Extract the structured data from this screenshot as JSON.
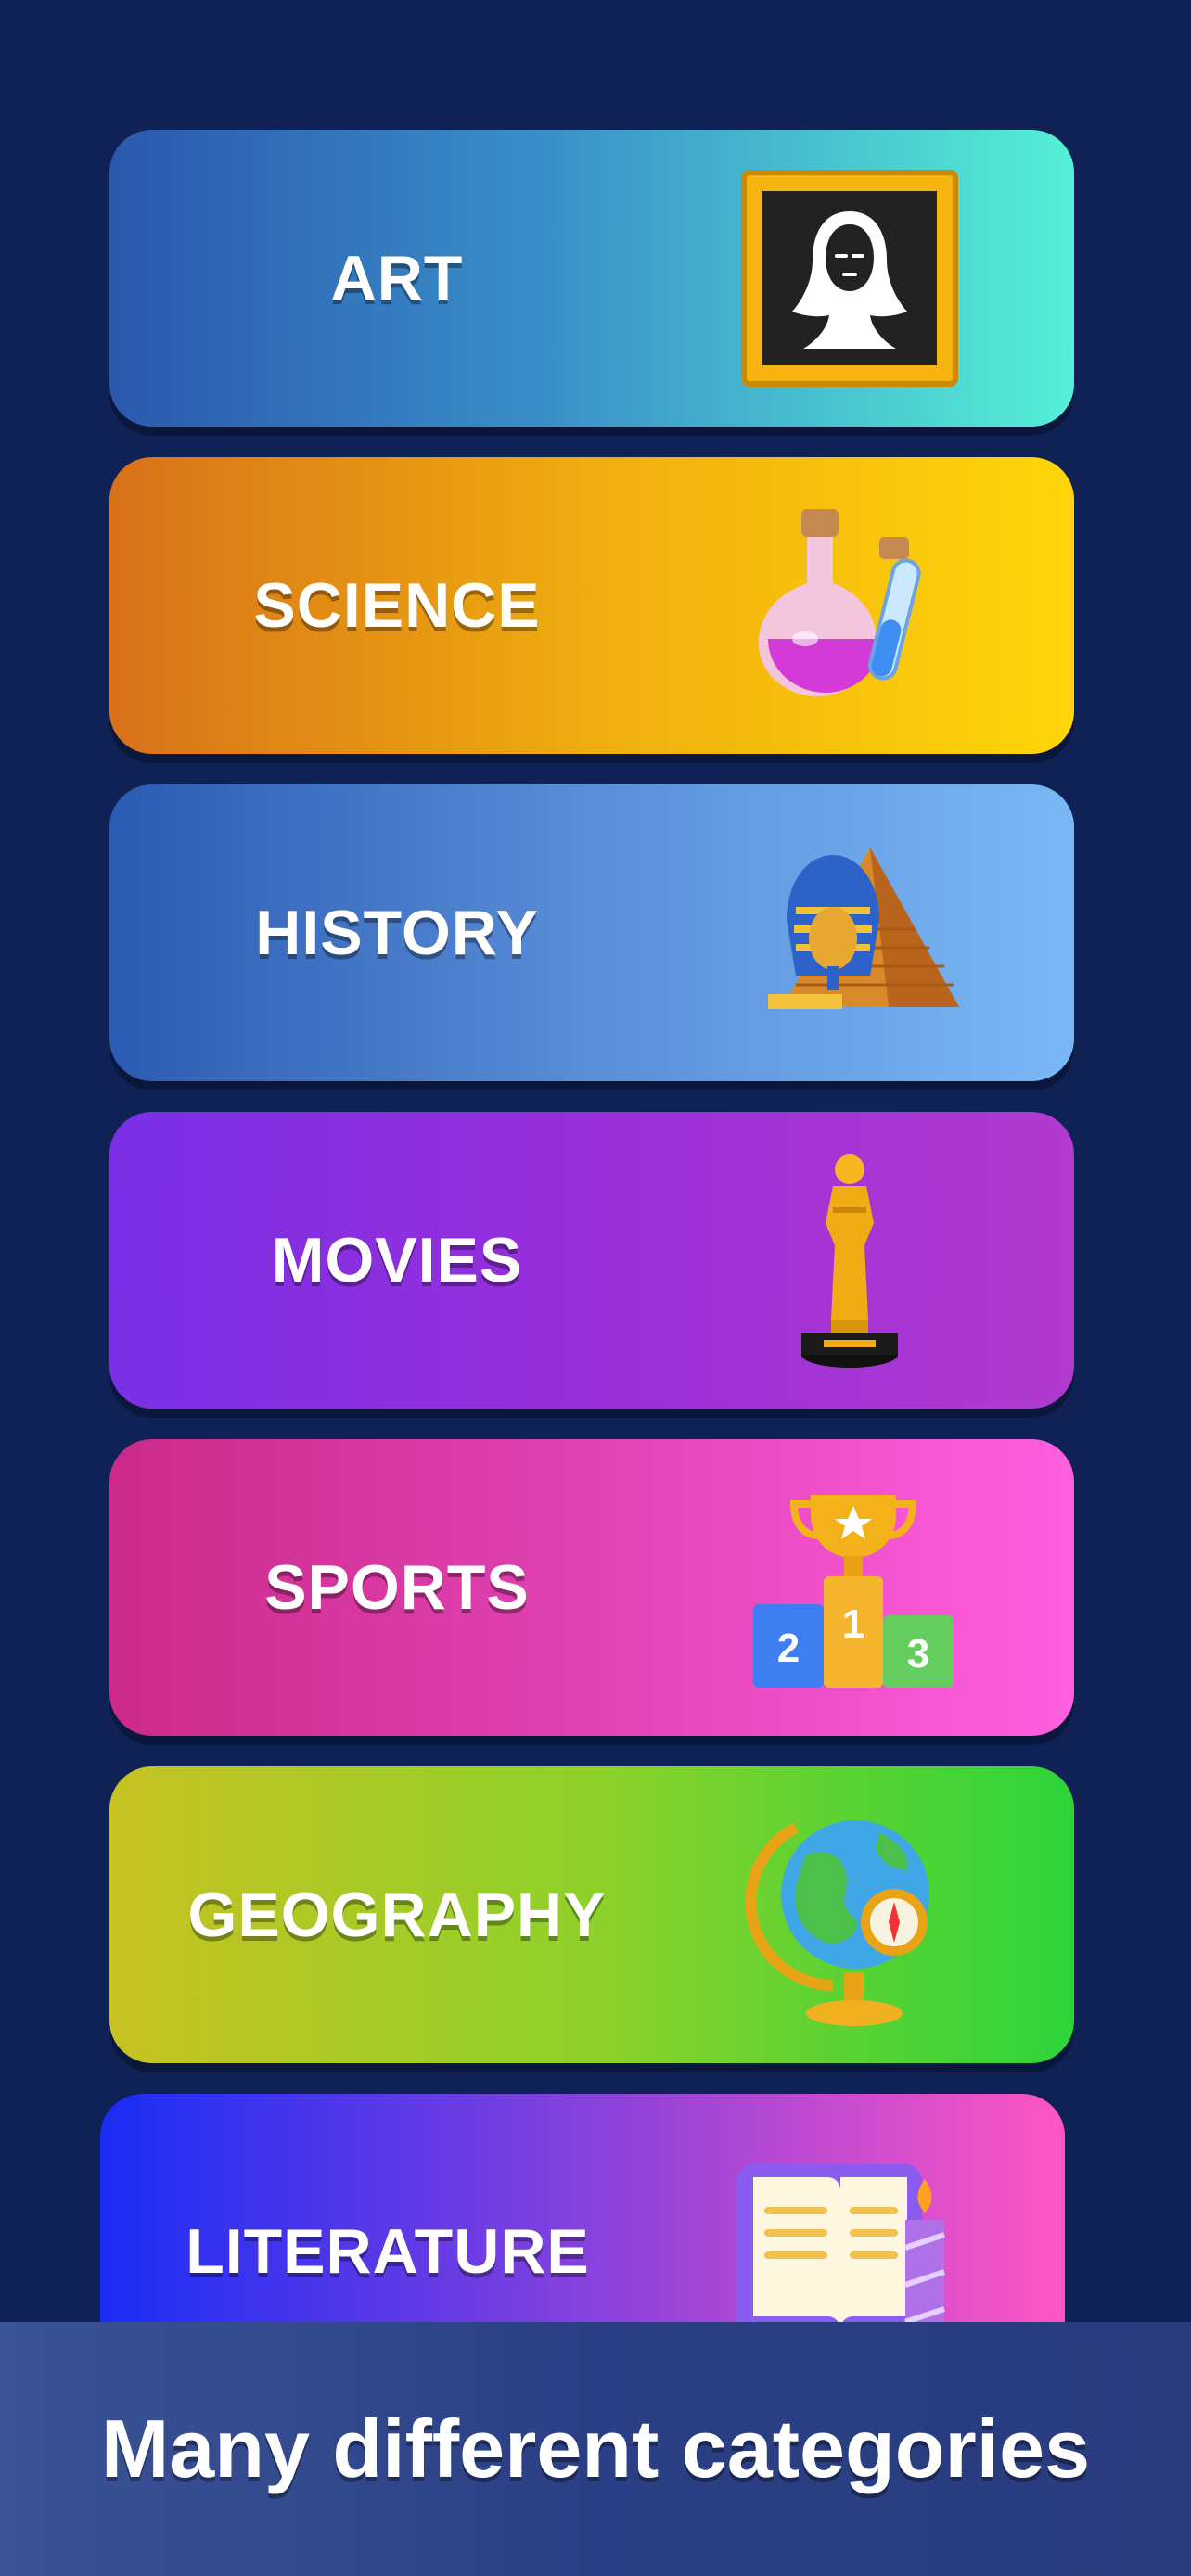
{
  "categories": [
    {
      "label": "ART",
      "icon": "mona-lisa-frame-icon"
    },
    {
      "label": "SCIENCE",
      "icon": "potion-flasks-icon"
    },
    {
      "label": "HISTORY",
      "icon": "pharaoh-pyramid-icon"
    },
    {
      "label": "MOVIES",
      "icon": "oscar-statuette-icon"
    },
    {
      "label": "SPORTS",
      "icon": "trophy-podium-icon"
    },
    {
      "label": "GEOGRAPHY",
      "icon": "globe-compass-icon"
    },
    {
      "label": "LITERATURE",
      "icon": "book-candle-icon"
    }
  ],
  "podium": {
    "first": "1",
    "second": "2",
    "third": "3"
  },
  "footer": {
    "tagline": "Many different categories"
  }
}
